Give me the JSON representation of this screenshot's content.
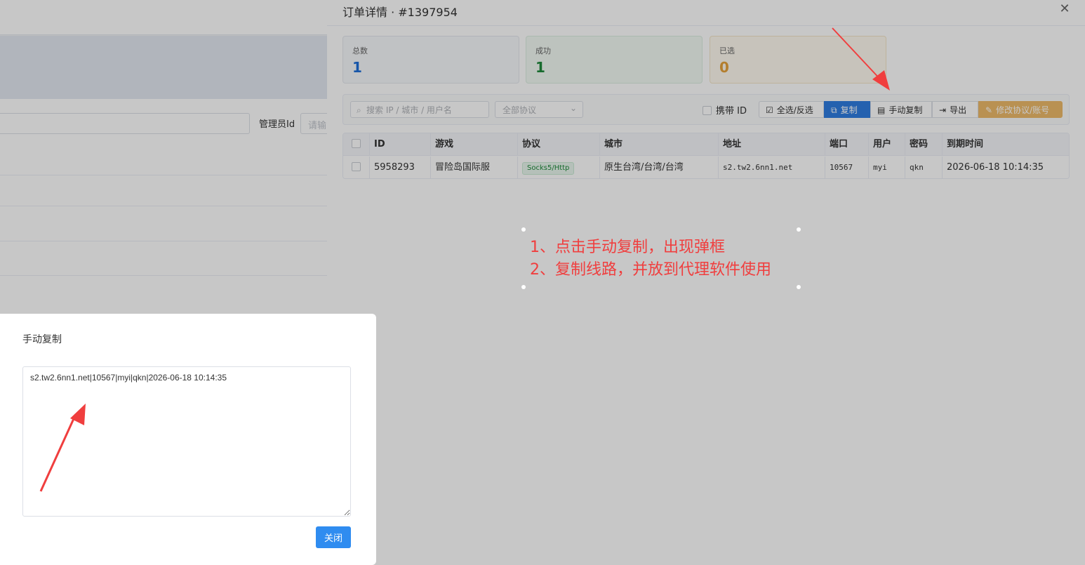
{
  "background_page": {
    "admin_id_label": "管理员Id",
    "admin_id_placeholder": "请输"
  },
  "drawer": {
    "title": "订单详情 · #1397954",
    "close_icon": "close-icon",
    "stats": {
      "total_label": "总数",
      "total_value": "1",
      "success_label": "成功",
      "success_value": "1",
      "selected_label": "已选",
      "selected_value": "0"
    },
    "toolbar": {
      "search_placeholder": "搜索 IP / 城市 / 用户名",
      "protocol_placeholder": "全部协议",
      "carry_id_label": "携带 ID",
      "select_all_label": "全选/反选",
      "copy_label": "复制",
      "manual_copy_label": "手动复制",
      "export_label": "导出",
      "modify_label": "修改协议/账号"
    },
    "table": {
      "headers": [
        "ID",
        "游戏",
        "协议",
        "城市",
        "地址",
        "端口",
        "用户",
        "密码",
        "到期时间"
      ],
      "rows": [
        {
          "id": "5958293",
          "game": "冒险岛国际服",
          "protocol": "Socks5/Http",
          "city": "原生台湾/台湾/台湾",
          "address": "s2.tw2.6nn1.net",
          "port": "10567",
          "user": "myi",
          "password": "qkn",
          "expire": "2026-06-18 10:14:35"
        }
      ]
    }
  },
  "annotation": {
    "line1": "1、点击手动复制，出现弹框",
    "line2": "2、复制线路，并放到代理软件使用",
    "color": "#f03e3e"
  },
  "modal": {
    "title": "手动复制",
    "content": "s2.tw2.6nn1.net|10567|myi|qkn|2026-06-18 10:14:35",
    "close_label": "关闭"
  },
  "colors": {
    "primary": "#2f7de1",
    "success": "#1f8a3b",
    "warning": "#e6a23c"
  }
}
